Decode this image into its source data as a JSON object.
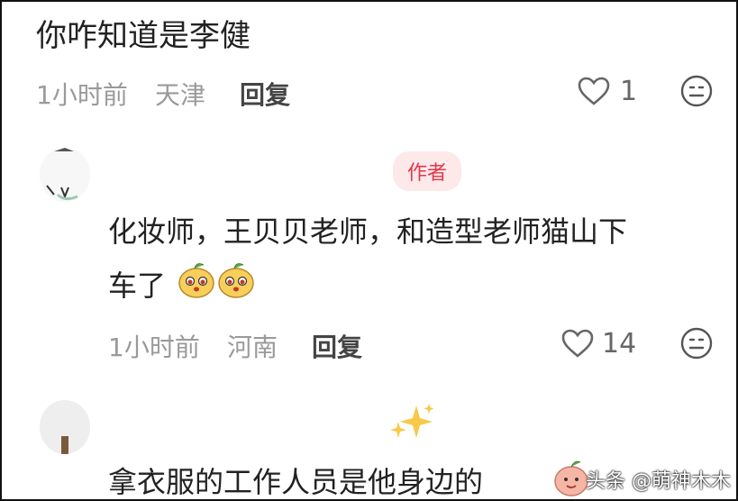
{
  "comment1": {
    "text": "你咋知道是李健",
    "time": "1小时前",
    "location": "天津",
    "reply_label": "回复",
    "like_count": "1"
  },
  "comment2": {
    "author_badge": "作者",
    "text_line1": "化妆师，王贝贝老师，和造型老师猫山下",
    "text_line2": "车了",
    "time": "1小时前",
    "location": "河南",
    "reply_label": "回复",
    "like_count": "14"
  },
  "comment3": {
    "text": "拿衣服的工作人员是他身边的"
  },
  "watermark": {
    "text": "头条 @萌神木木"
  },
  "colors": {
    "author_badge_bg": "#fde8ea",
    "author_badge_fg": "#e0394a",
    "meta_gray": "#9a9a9a",
    "text_dark": "#222222"
  },
  "icons": {
    "like": "heart-outline-icon",
    "emoji": "smiley-face-icon",
    "sticker": "mango-sticker-icon",
    "sparkle": "sparkles-icon"
  }
}
